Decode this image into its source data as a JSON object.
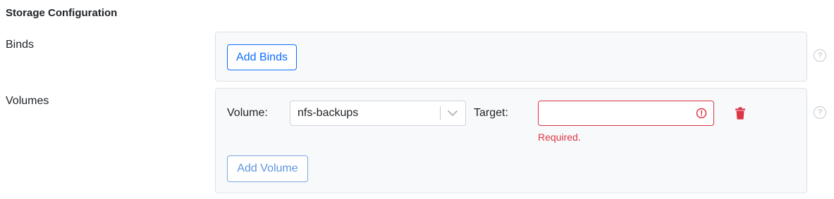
{
  "section": {
    "title": "Storage Configuration"
  },
  "binds": {
    "label": "Binds",
    "add_button": "Add Binds",
    "help_icon": "?"
  },
  "volumes": {
    "label": "Volumes",
    "volume_label": "Volume:",
    "volume_value": "nfs-backups",
    "target_label": "Target:",
    "target_value": "",
    "target_error": "Required.",
    "add_button": "Add Volume",
    "help_icon": "?"
  },
  "icons": {
    "chevron": "chevron-down-icon",
    "alert": "alert-circle-icon",
    "trash": "trash-icon",
    "help": "question-circle-icon"
  },
  "colors": {
    "primary": "#0d6efd",
    "danger": "#dc3545",
    "panel_bg": "#f8f9fa",
    "panel_border": "#dee2e6"
  }
}
